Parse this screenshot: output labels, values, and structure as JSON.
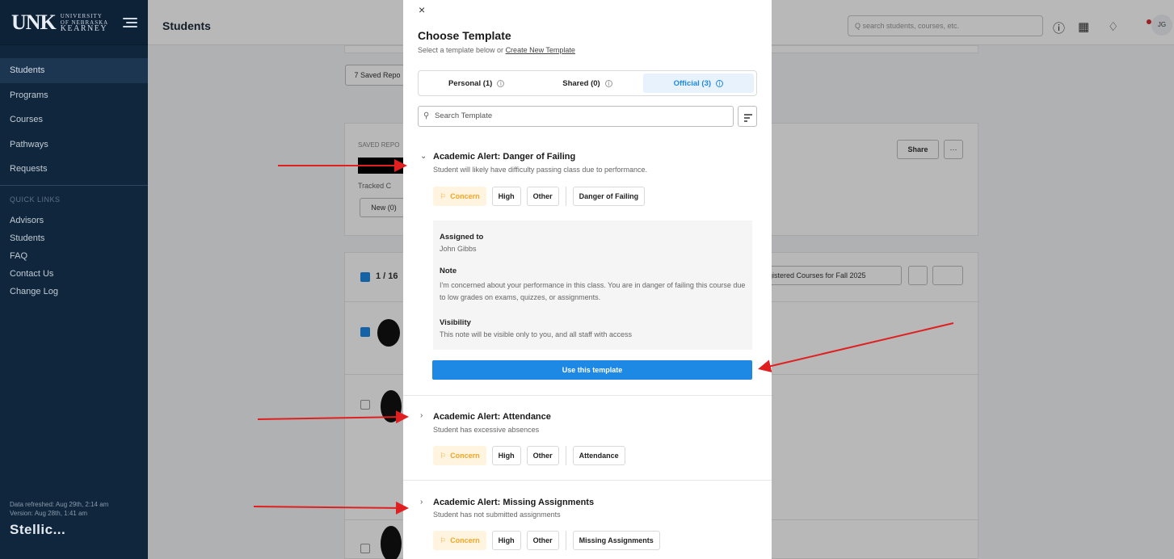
{
  "sidebar": {
    "logo": {
      "mark": "UNK",
      "line1": "UNIVERSITY",
      "line2": "OF NEBRASKA",
      "line3": "KEARNEY"
    },
    "nav": [
      "Students",
      "Programs",
      "Courses",
      "Pathways",
      "Requests"
    ],
    "active_nav": "Students",
    "quick_links_title": "QUICK LINKS",
    "quick_links": [
      "Advisors",
      "Students",
      "FAQ",
      "Contact Us",
      "Change Log"
    ],
    "data_refreshed": "Data refreshed: Aug 29th, 2:14 am",
    "version": "Version: Aug 28th, 1:41 am",
    "brand": "Stellic..."
  },
  "topbar": {
    "page_title": "Students",
    "search_placeholder": "Q search students, courses, etc.",
    "avatar_initials": "JG"
  },
  "background": {
    "saved_reports_btn": "7 Saved Repo",
    "saved_report_label": "SAVED REPO",
    "tracked_label": "Tracked C",
    "new_btn": "New (0)",
    "share_btn": "Share",
    "more_btn": "···",
    "count": "1 / 16",
    "courses_dropdown": "gistered Courses for Fall 2025"
  },
  "modal": {
    "close": "×",
    "title": "Choose Template",
    "subtitle_prefix": "Select a template below or ",
    "subtitle_link": "Create New Template",
    "tabs": [
      {
        "label": "Personal (1)",
        "active": false
      },
      {
        "label": "Shared (0)",
        "active": false
      },
      {
        "label": "Official (3)",
        "active": true
      }
    ],
    "search_placeholder": "Search Template",
    "templates": [
      {
        "title": "Academic Alert: Danger of Failing",
        "desc": "Student will likely have difficulty passing class due to performance.",
        "expanded": true,
        "tags": [
          "Concern",
          "High",
          "Other",
          "Danger of Failing"
        ],
        "assigned_label": "Assigned to",
        "assigned_value": "John Gibbs",
        "note_label": "Note",
        "note_value": "I'm concerned about your performance in this class. You are in danger of failing this course due to low grades on exams, quizzes, or assignments.",
        "visibility_label": "Visibility",
        "visibility_value": "This note will be visible only to you, and all staff with access",
        "use_button": "Use this template"
      },
      {
        "title": "Academic Alert: Attendance",
        "desc": "Student has excessive absences",
        "expanded": false,
        "tags": [
          "Concern",
          "High",
          "Other",
          "Attendance"
        ]
      },
      {
        "title": "Academic Alert: Missing Assignments",
        "desc": "Student has not submitted assignments",
        "expanded": false,
        "tags": [
          "Concern",
          "High",
          "Other",
          "Missing Assignments"
        ]
      }
    ]
  },
  "colors": {
    "accent": "#1e88e5",
    "concern": "#f5a623",
    "sidebar": "#10263c",
    "arrow": "#e02020"
  }
}
